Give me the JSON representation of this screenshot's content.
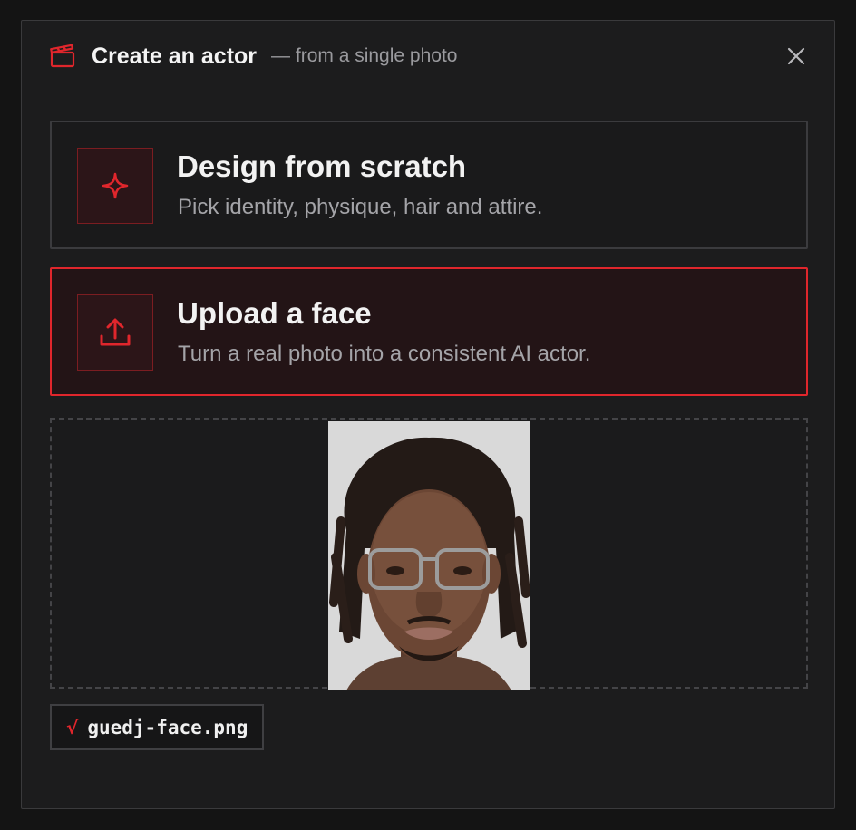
{
  "header": {
    "title": "Create an actor",
    "subtitle": "— from a single photo"
  },
  "options": [
    {
      "title": "Design from scratch",
      "description": "Pick identity, physique, hair and attire.",
      "icon": "sparkle-icon",
      "selected": false
    },
    {
      "title": "Upload a face",
      "description": "Turn a real photo into a consistent AI actor.",
      "icon": "upload-icon",
      "selected": true
    }
  ],
  "upload": {
    "file_name": "guedj-face.png",
    "status_glyph": "√"
  },
  "colors": {
    "accent": "#e0262c",
    "background": "#1c1c1d",
    "border": "#3b3b3e",
    "title_text": "#f4f4f4",
    "muted_text": "#9a9a9e"
  }
}
